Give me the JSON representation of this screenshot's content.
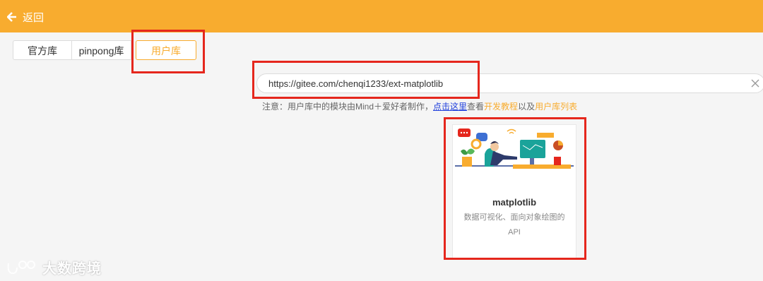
{
  "header": {
    "back_label": "返回"
  },
  "tabs": [
    {
      "label": "官方库",
      "active": false
    },
    {
      "label": "pinpong库",
      "active": false
    },
    {
      "label": "用户库",
      "active": true
    }
  ],
  "url_input": {
    "value": "https://gitee.com/chenqi1233/ext-matplotlib"
  },
  "note": {
    "prefix": "注意：用户库中的模块由Mind＋爱好者制作，",
    "link": "点击这里",
    "mid1": "查看",
    "tutorial": "开发教程",
    "mid2": "以及",
    "list": "用户库列表"
  },
  "card": {
    "name": "matplotlib",
    "desc_line1": "数据可视化、面向对象绘图的",
    "desc_line2": "API"
  },
  "watermark": {
    "text": "大数跨境"
  },
  "colors": {
    "accent": "#f8ac2f",
    "highlight": "#e5271d",
    "link": "#1f3fdc"
  }
}
